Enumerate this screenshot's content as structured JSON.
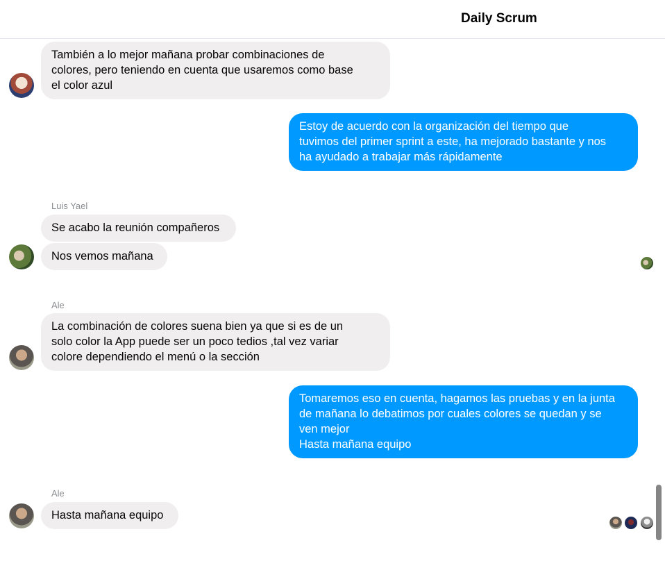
{
  "header": {
    "title": "Daily Scrum"
  },
  "messages": [
    {
      "side": "in",
      "sender": "",
      "text": "También a lo mejor mañana probar combinaciones de\ncolores, pero teniendo en cuenta que usaremos como base\nel color azul"
    },
    {
      "side": "out",
      "sender": "",
      "text": "Estoy de acuerdo con la organización del tiempo que\ntuvimos del primer sprint a este, ha mejorado bastante y nos\nha ayudado a trabajar más rápidamente"
    },
    {
      "side": "in",
      "sender": "Luis Yael",
      "text": "Se acabo la reunión compañeros"
    },
    {
      "side": "in",
      "sender": "",
      "text": "Nos vemos mañana"
    },
    {
      "side": "in",
      "sender": "Ale",
      "text": "La combinación de colores suena bien ya que si es de un\nsolo color la App puede ser un poco tedios ,tal vez variar\ncolore dependiendo el menú o la sección"
    },
    {
      "side": "out",
      "sender": "",
      "text": "Tomaremos eso en cuenta, hagamos las pruebas y en la junta\nde mañana lo debatimos por cuales colores se quedan y se\nven mejor\nHasta mañana equipo"
    },
    {
      "side": "in",
      "sender": "Ale",
      "text": "Hasta mañana equipo"
    }
  ],
  "colors": {
    "outgoing_bubble": "#0099ff",
    "incoming_bubble": "#f0eeee",
    "sender_label": "#8a8d91"
  }
}
